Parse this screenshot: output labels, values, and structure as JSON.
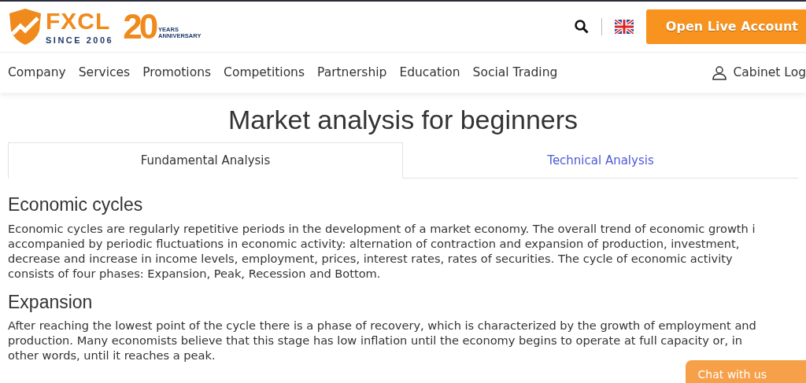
{
  "header": {
    "logo": {
      "brand": "FXCL",
      "since": "SINCE 2006",
      "anniversary_number": "20",
      "anniversary_text": [
        "YEARS",
        "ANNIVERSARY"
      ]
    },
    "cta": "Open Live Account"
  },
  "nav": {
    "items": [
      "Company",
      "Services",
      "Promotions",
      "Competitions",
      "Partnership",
      "Education",
      "Social Trading"
    ],
    "login": "Cabinet Log"
  },
  "page_title": "Market analysis for beginners",
  "tabs": [
    {
      "label": "Fundamental Analysis",
      "selected": true
    },
    {
      "label": "Technical Analysis",
      "selected": false
    }
  ],
  "sections": [
    {
      "heading": "Economic cycles",
      "lines": [
        "Economic cycles are regularly repetitive periods in the development of a market economy. The overall trend of economic growth i",
        "accompanied by periodic fluctuations in economic activity: alternation of contraction and expansion of production, investment,",
        "decrease and increase in income levels, employment, prices, interest rates, rates of securities. The cycle of economic activity",
        "consists of four phases: Expansion, Peak, Recession and Bottom."
      ]
    },
    {
      "heading": "Expansion",
      "lines": [
        "After reaching the lowest point of the cycle there is a phase of recovery, which is characterized by the growth of employment and",
        "production. Many economists believe that this stage has low inflation until the economy begins to operate at full capacity or, in",
        "other words, until it reaches a peak."
      ]
    }
  ],
  "chat": "Chat with us"
}
